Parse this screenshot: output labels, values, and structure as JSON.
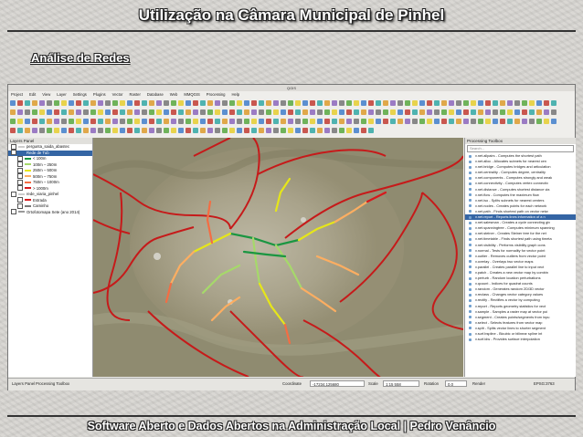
{
  "slide": {
    "title": "Utilização na Câmara Municipal de Pinhel",
    "section_title": "Análise de Redes",
    "footer": "Software Aberto e Dados Abertos na Administração Local   |   Pedro Venâncio"
  },
  "qgis": {
    "window_title": "QGIS",
    "menu": [
      "Project",
      "Edit",
      "View",
      "Layer",
      "Settings",
      "Plugins",
      "Vector",
      "Raster",
      "Database",
      "Web",
      "MMQGIS",
      "Processing",
      "Help"
    ],
    "layers_panel": {
      "title": "Layers Panel",
      "layers": [
        {
          "label": "pergunta_saida_abastec",
          "color": "#cccccc",
          "selected": false
        },
        {
          "label": "Rede de Tub",
          "color": "#3465a4",
          "selected": true
        },
        {
          "label": "< 100m",
          "color": "#1a9641",
          "selected": false
        },
        {
          "label": "100m – 250m",
          "color": "#a6d96a",
          "selected": false
        },
        {
          "label": "250m – 500m",
          "color": "#e6e619",
          "selected": false
        },
        {
          "label": "500m – 750m",
          "color": "#fdae61",
          "selected": false
        },
        {
          "label": "750m – 1000m",
          "color": "#f46d43",
          "selected": false
        },
        {
          "label": "> 1000m",
          "color": "#d7191c",
          "selected": false
        },
        {
          "label": "rede_viaria_pinhel",
          "color": "#cccccc",
          "selected": false
        },
        {
          "label": "Estrada",
          "color": "#d7191c",
          "selected": false
        },
        {
          "label": "Caminho",
          "color": "#777777",
          "selected": false
        },
        {
          "label": "Ortofotomapa Sete (ano 2014)",
          "color": "#999999",
          "selected": false
        }
      ],
      "bottom_tabs": [
        "Layers Panel",
        "Processing Toolbox"
      ]
    },
    "toolbox": {
      "title": "Processing Toolbox",
      "search_placeholder": "Search...",
      "tools": [
        "v.net.allpairs - Computes the shortest path",
        "v.net.alloc - Allocates subnets for nearest cen",
        "v.net.bridge - Computes bridges and articulation",
        "v.net.centrality - Computes degree, centrality",
        "v.net.components - Computes strongly and weak",
        "v.net.connectivity - Computes vertex connectiv",
        "v.net.distance - Computes shortest distance via",
        "v.net.flow - Computes the maximum flow",
        "v.net.iso - Splits subnets for nearest centers",
        "v.net.nodes - Creates points for each network",
        "v.net.path - Finds shortest path on vector netw",
        "v.net.report - Reports lines information of a n",
        "v.net.salesman - Creates a cycle connecting giv",
        "v.net.spanningtree - Computes minimum spanning",
        "v.net.steiner - Creates Steiner tree for the net",
        "v.net.timetable - Finds shortest path using timeta",
        "v.net.visibility - Performs visibility graph cons",
        "v.normal - Tests for normality for vector point",
        "v.outlier - Removes outliers from vector point",
        "v.overlay - Overlays two vector maps",
        "v.parallel - Creates parallel line to input vect",
        "v.patch - Creates a new vector map by combin",
        "v.perturb - Random location perturbations",
        "v.qcount - Indices for quadrat counts",
        "v.random - Generates random 2D/3D vector",
        "v.reclass - Changes vector category values",
        "v.rectify - Rectifies a vector by computing",
        "v.report - Reports geometry statistics for vect",
        "v.sample - Samples a raster map at vector poi",
        "v.segment - Creates points/segments from inpu",
        "v.select - Selects features from vector map",
        "v.split - Splits vector lines to shorter segment",
        "v.surf.bspline - Bicubic or bilinear spline int",
        "v.surf.idw - Provides surface interpolation"
      ],
      "selected_index": 11
    },
    "statusbar": {
      "coordinate_label": "Coordinate",
      "coordinate": "-17234,125680",
      "scale_label": "Scale",
      "scale": "1:15 558",
      "rotation_label": "Rotation",
      "rotation": "0.0",
      "render_label": "Render",
      "crs": "EPSG:3763"
    }
  }
}
